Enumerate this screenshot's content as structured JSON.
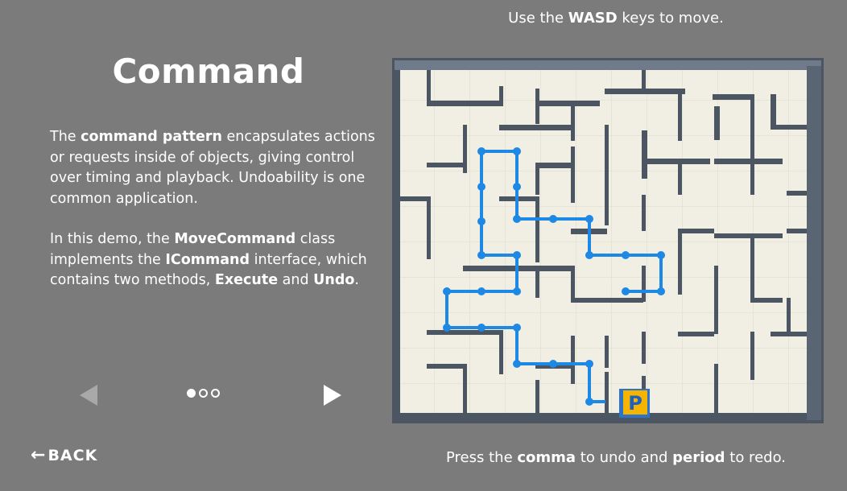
{
  "slide": {
    "title": "Command",
    "paragraph1": [
      {
        "text": "The ",
        "bold": false
      },
      {
        "text": "command pattern",
        "bold": true
      },
      {
        "text": " encapsulates actions or requests inside of objects, giving control over timing and playback. Undoability is one common application.",
        "bold": false
      }
    ],
    "paragraph2": [
      {
        "text": "In this demo, the ",
        "bold": false
      },
      {
        "text": "MoveCommand",
        "bold": true
      },
      {
        "text": " class implements the ",
        "bold": false
      },
      {
        "text": "ICommand",
        "bold": true
      },
      {
        "text": " interface, which contains two methods, ",
        "bold": false
      },
      {
        "text": "Execute",
        "bold": true
      },
      {
        "text": " and ",
        "bold": false
      },
      {
        "text": "Undo",
        "bold": true
      },
      {
        "text": ".",
        "bold": false
      }
    ]
  },
  "pagination": {
    "total": 3,
    "current": 1
  },
  "back_label": "BACK",
  "hints": {
    "top": [
      {
        "text": "Use the ",
        "bold": false
      },
      {
        "text": "WASD",
        "bold": true
      },
      {
        "text": " keys to move.",
        "bold": false
      }
    ],
    "bottom": [
      {
        "text": "Press the ",
        "bold": false
      },
      {
        "text": "comma",
        "bold": true
      },
      {
        "text": " to undo and ",
        "bold": false
      },
      {
        "text": "period",
        "bold": true
      },
      {
        "text": " to redo.",
        "bold": false
      }
    ]
  },
  "player_label": "P",
  "colors": {
    "background": "#7b7b7b",
    "maze_floor": "#f1efe4",
    "maze_wall": "#4c5663",
    "path": "#1e88e5",
    "player": "#f5b400"
  },
  "icons": {
    "prev": "triangle-left-icon",
    "next": "triangle-right-icon",
    "back": "arrow-left-icon"
  }
}
